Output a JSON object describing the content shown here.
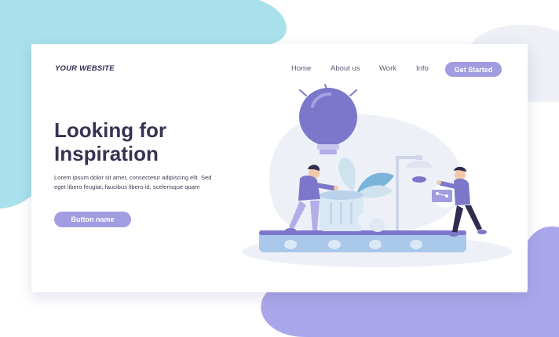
{
  "header": {
    "brand": "YOUR WEBSITE",
    "nav": [
      "Home",
      "About us",
      "Work",
      "Info"
    ],
    "cta_label": "Get Started"
  },
  "hero": {
    "title_line1": "Looking for",
    "title_line2": "Inspiration",
    "body": "Lorem ipsum dolor sit amet, consectetur adipiscing elit. Sed eget libero feugiat, faucibus libero id, scelerisque quam",
    "button_label": "Button name"
  },
  "colors": {
    "accent": "#a29ce0",
    "heading": "#363352",
    "blob_top_left": "#a8e1ec",
    "blob_bottom_right": "#aaa6ea",
    "bulb": "#7d77cc",
    "conveyor": "#a9c8ea"
  },
  "icons": [
    "light-bulb-icon",
    "plant-icon",
    "lamp-icon",
    "speech-bubble-icon"
  ]
}
